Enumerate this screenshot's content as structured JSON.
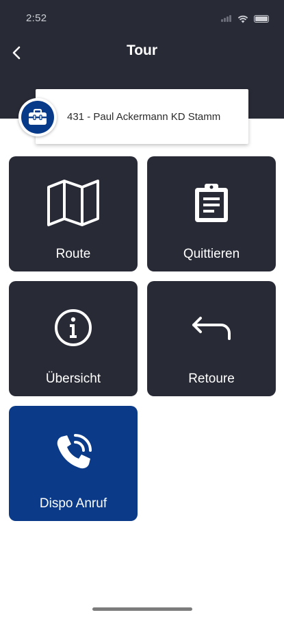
{
  "status_bar": {
    "time": "2:52"
  },
  "nav": {
    "title": "Tour"
  },
  "tour_selector": {
    "label": "431 - Paul Ackermann KD Stamm"
  },
  "tiles": [
    {
      "label": "Route",
      "icon": "map-icon"
    },
    {
      "label": "Quittieren",
      "icon": "clipboard-icon"
    },
    {
      "label": "Übersicht",
      "icon": "info-icon"
    },
    {
      "label": "Retoure",
      "icon": "return-arrow-icon"
    },
    {
      "label": "Dispo Anruf",
      "icon": "phone-call-icon"
    }
  ],
  "colors": {
    "header": "#282a36",
    "tile": "#282a36",
    "accent_tile": "#0a3a88"
  }
}
